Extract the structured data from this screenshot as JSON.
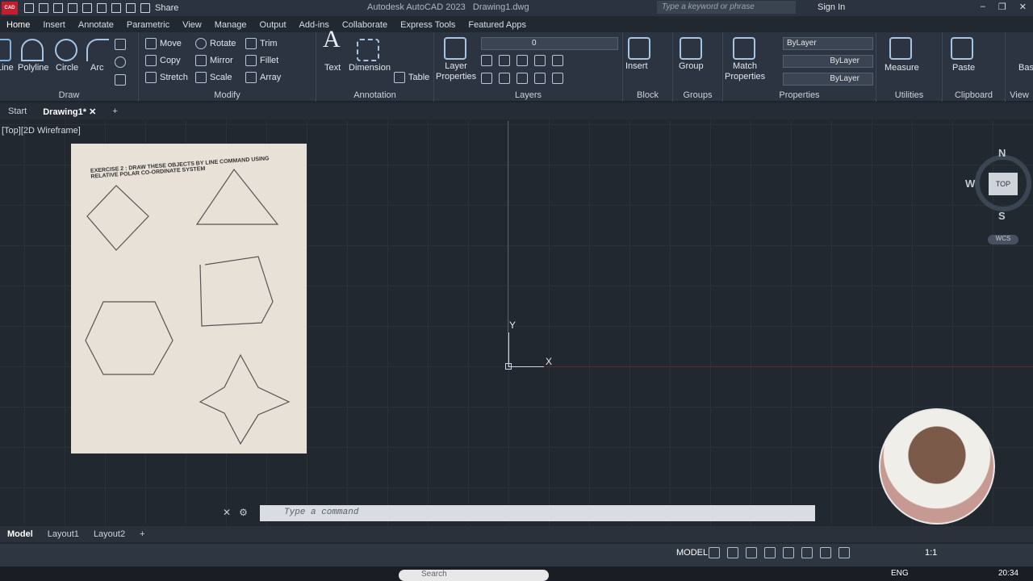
{
  "titlebar": {
    "share_label": "Share",
    "app_name": "Autodesk AutoCAD 2023",
    "file_name": "Drawing1.dwg",
    "search_placeholder": "Type a keyword or phrase",
    "sign_in": "Sign In",
    "logo_text": "CAD"
  },
  "menu_tabs": [
    "Home",
    "Insert",
    "Annotate",
    "Parametric",
    "View",
    "Manage",
    "Output",
    "Add-ins",
    "Collaborate",
    "Express Tools",
    "Featured Apps"
  ],
  "ribbon": {
    "draw": {
      "line": "Line",
      "polyline": "Polyline",
      "circle": "Circle",
      "arc": "Arc",
      "title": "Draw"
    },
    "modify": {
      "move": "Move",
      "rotate": "Rotate",
      "trim": "Trim",
      "copy": "Copy",
      "mirror": "Mirror",
      "fillet": "Fillet",
      "stretch": "Stretch",
      "scale": "Scale",
      "array": "Array",
      "title": "Modify"
    },
    "annotation": {
      "text": "Text",
      "dimension": "Dimension",
      "table": "Table",
      "title": "Annotation"
    },
    "layers": {
      "layer_properties": "Layer Properties",
      "current_layer": "0",
      "title": "Layers"
    },
    "block": {
      "insert": "Insert",
      "title": "Block"
    },
    "groups": {
      "group": "Group",
      "title": "Groups"
    },
    "properties": {
      "match": "Match Properties",
      "color": "ByLayer",
      "linetype": "ByLayer",
      "lineweight": "ByLayer",
      "title": "Properties"
    },
    "utilities": {
      "measure": "Measure",
      "title": "Utilities"
    },
    "clipboard": {
      "paste": "Paste",
      "title": "Clipboard"
    },
    "view": {
      "base": "Base",
      "title": "View"
    }
  },
  "file_tabs": [
    "Start",
    "Drawing1*"
  ],
  "viewport_label": "[Top][2D Wireframe]",
  "viewcube": {
    "n": "N",
    "s": "S",
    "w": "W",
    "top": "TOP",
    "wcs": "WCS"
  },
  "ucs": {
    "y": "Y",
    "x": "X"
  },
  "command_line": {
    "placeholder": "Type a command"
  },
  "layout_tabs": [
    "Model",
    "Layout1",
    "Layout2"
  ],
  "status": {
    "model": "MODEL",
    "scale": "1:1"
  },
  "taskbar": {
    "search": "Search",
    "lang": "ENG",
    "time": "20:34"
  },
  "paper": {
    "exercise_title": "EXERCISE 2 : DRAW THESE OBJECTS BY LINE COMMAND USING RELATIVE POLAR CO-ORDINATE SYSTEM"
  }
}
